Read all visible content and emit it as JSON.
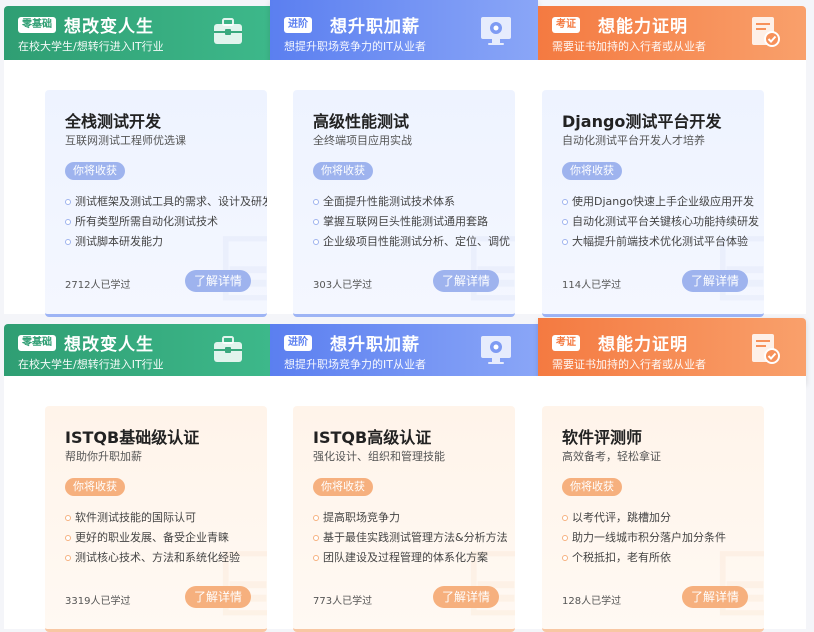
{
  "sections": [
    {
      "tabs": [
        {
          "badge": "零基础",
          "title": "想改变人生",
          "subtitle": "在校大学生/想转行进入IT行业",
          "icon": "briefcase-icon"
        },
        {
          "badge": "进阶",
          "title": "想升职加薪",
          "subtitle": "想提升职场竞争力的IT从业者",
          "icon": "monitor-gear-icon"
        },
        {
          "badge": "考证",
          "title": "想能力证明",
          "subtitle": "需要证书加持的入行者或从业者",
          "icon": "certificate-icon"
        }
      ],
      "active_tab": "进阶",
      "cards": [
        {
          "title": "全栈测试开发",
          "subtitle": "互联网测试工程师优选课",
          "gain_label": "你将收获",
          "points": [
            "测试框架及测试工具的需求、设计及研发",
            "所有类型所需自动化测试技术",
            "测试脚本研发能力"
          ],
          "learners": "2712人已学过",
          "detail_label": "了解详情"
        },
        {
          "title": "高级性能测试",
          "subtitle": "全终端项目应用实战",
          "gain_label": "你将收获",
          "points": [
            "全面提升性能测试技术体系",
            "掌握互联网巨头性能测试通用套路",
            "企业级项目性能测试分析、定位、调优"
          ],
          "learners": "303人已学过",
          "detail_label": "了解详情"
        },
        {
          "title": "Django测试平台开发",
          "subtitle": "自动化测试平台开发人才培养",
          "gain_label": "你将收获",
          "points": [
            "使用Django快速上手企业级应用开发",
            "自动化测试平台关键核心功能持续研发",
            "大幅提升前端技术优化测试平台体验"
          ],
          "learners": "114人已学过",
          "detail_label": "了解详情"
        }
      ]
    },
    {
      "tabs": [
        {
          "badge": "零基础",
          "title": "想改变人生",
          "subtitle": "在校大学生/想转行进入IT行业",
          "icon": "briefcase-icon"
        },
        {
          "badge": "进阶",
          "title": "想升职加薪",
          "subtitle": "想提升职场竞争力的IT从业者",
          "icon": "monitor-gear-icon"
        },
        {
          "badge": "考证",
          "title": "想能力证明",
          "subtitle": "需要证书加持的入行者或从业者",
          "icon": "certificate-icon"
        }
      ],
      "active_tab": "考证",
      "cards": [
        {
          "title": "ISTQB基础级认证",
          "subtitle": "帮助你升职加薪",
          "gain_label": "你将收获",
          "points": [
            "软件测试技能的国际认可",
            "更好的职业发展、备受企业青睐",
            "测试核心技术、方法和系统化经验"
          ],
          "learners": "3319人已学过",
          "detail_label": "了解详情"
        },
        {
          "title": "ISTQB高级认证",
          "subtitle": "强化设计、组织和管理技能",
          "gain_label": "你将收获",
          "points": [
            "提高职场竞争力",
            "基于最佳实践测试管理方法&分析方法",
            "团队建设及过程管理的体系化方案"
          ],
          "learners": "773人已学过",
          "detail_label": "了解详情"
        },
        {
          "title": "软件评测师",
          "subtitle": "高效备考，轻松拿证",
          "gain_label": "你将收获",
          "points": [
            "以考代评，跳槽加分",
            "助力一线城市积分落户加分条件",
            "个税抵扣，老有所依"
          ],
          "learners": "128人已学过",
          "detail_label": "了解详情"
        }
      ]
    }
  ],
  "colors": {
    "green": "#2f9e73",
    "blue": "#5b7ff0",
    "orange": "#f47a41",
    "blue_soft": "#9eb3ee",
    "orange_soft": "#f6b07e"
  }
}
